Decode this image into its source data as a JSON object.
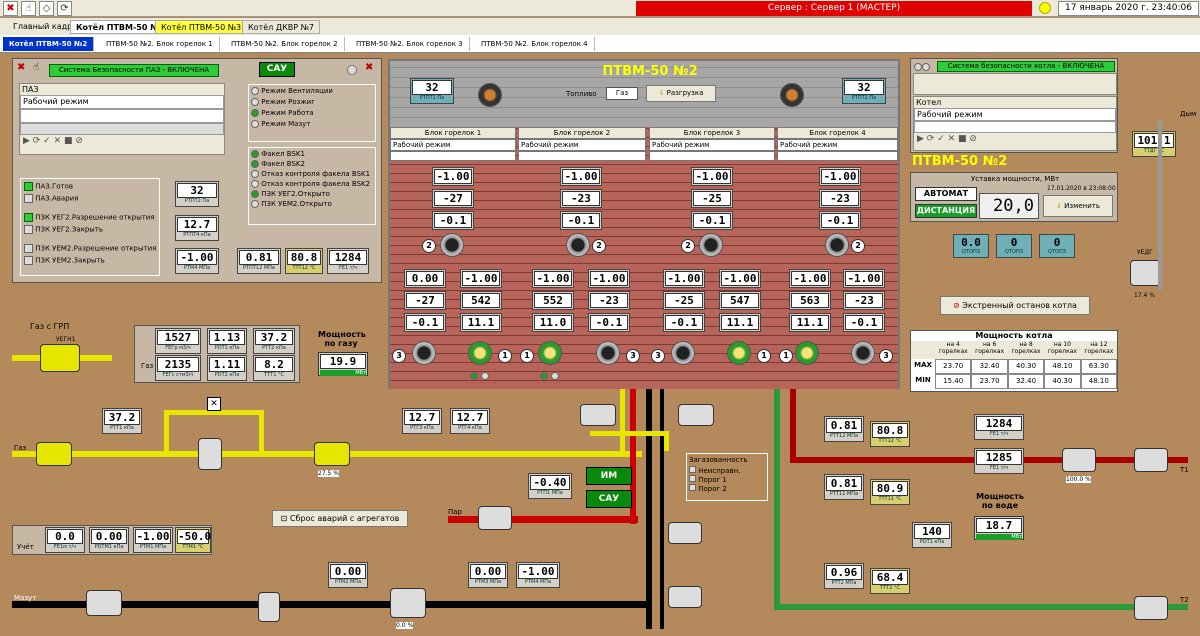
{
  "topbar": {
    "server": "Сервер : Сервер 1 (МАСТЕР)",
    "clock": "17 январь 2020 г. 23:40:06"
  },
  "tabs1": [
    "Главный кадр",
    "Котёл ПТВМ-50 №2",
    "Котёл ПТВМ-50 №3",
    "Котёл ДКВР №7"
  ],
  "tabs2": [
    "Котёл ПТВМ-50 №2",
    "ПТВМ-50 №2. Блок горелок 1",
    "ПТВМ-50 №2. Блок горелок 2",
    "ПТВМ-50 №2. Блок горелок 3",
    "ПТВМ-50 №2. Блок горелок 4"
  ],
  "paz": {
    "status": "Система Безопасности ПАЗ - ВКЛЮЧЕНА",
    "sau": "САУ",
    "title": "ПАЗ",
    "mode": "Рабочий режим",
    "modes": [
      "Режим Вентиляции",
      "Режим Розжиг",
      "Режим Работа",
      "Режим Мазут"
    ],
    "flares": [
      "Факел BSK1",
      "Факел BSK2",
      "Отказ контроля факела BSK1",
      "Отказ контроля факела BSK2",
      "ПЗК УЕГ2.Открыто",
      "ПЗК УЕМ2.Открыто"
    ],
    "flags1": [
      "ПАЗ.Готов",
      "ПАЗ.Авария"
    ],
    "flags2": [
      "ПЗК УЕГ2.Разрешение открытия",
      "ПЗК УЕГ2.Закрыть"
    ],
    "flags3": [
      "ПЗК УЕМ2.Разрешение открытия",
      "ПЗК УЕМ2.Закрыть"
    ]
  },
  "center": {
    "title": "ПТВМ-50 №2",
    "fuel_label": "Топливо",
    "fuel": "Газ",
    "unload": "Разгрузка",
    "rtpt1": "32",
    "rtpt2": "32"
  },
  "blocks": [
    {
      "name": "Блок горелок 1",
      "mode": "Рабочий режим",
      "top": [
        "-1.00",
        "-27",
        "-0.1"
      ],
      "l": [
        "0.00",
        "-27",
        "-0.1"
      ],
      "r": [
        "-1.00",
        "542",
        "11.1"
      ]
    },
    {
      "name": "Блок горелок 2",
      "mode": "Рабочий режим",
      "top": [
        "-1.00",
        "-23",
        "-0.1"
      ],
      "l": [
        "-1.00",
        "552",
        "11.0"
      ],
      "r": [
        "-1.00",
        "-23",
        "-0.1"
      ]
    },
    {
      "name": "Блок горелок 3",
      "mode": "Рабочий режим",
      "top": [
        "-1.00",
        "-25",
        "-0.1"
      ],
      "l": [
        "-1.00",
        "-25",
        "-0.1"
      ],
      "r": [
        "-1.00",
        "547",
        "11.1"
      ]
    },
    {
      "name": "Блок горелок 4",
      "mode": "Рабочий режим",
      "top": [
        "-1.00",
        "-23",
        "-0.1"
      ],
      "l": [
        "-1.00",
        "563",
        "11.1"
      ],
      "r": [
        "-1.00",
        "-23",
        "-0.1"
      ]
    }
  ],
  "right": {
    "status": "Система безопасности котла - ВКЛЮЧЕНА",
    "kotel": "Котел",
    "mode": "Рабочий режим",
    "title": "ПТВМ-50 №2",
    "setpoint_label": "Уставка мощности, МВт",
    "setdate": "17.01.2020 в 23:08:00",
    "auto": "АВТОМАТ",
    "dist": "ДИСТАНЦИЯ",
    "setval": "20,0",
    "change": "Изменить",
    "ttg": "101.1",
    "q1": "0.0",
    "q2": "0",
    "q3": "0",
    "estop": "Экстренный останов котла",
    "dym": "Дым",
    "uedg": "УЕДГ",
    "uedg_pct": "17.4 %",
    "power_title": "Мощность котла",
    "power_cols": [
      "на 4 горелках",
      "на 6 горелках",
      "на 8 горелках",
      "на 10 горелках",
      "на 12 горелках"
    ],
    "max": [
      "23.70",
      "32.40",
      "40.30",
      "48.10",
      "63.30"
    ],
    "min": [
      "15.40",
      "23.70",
      "32.40",
      "40.30",
      "48.10"
    ]
  },
  "gas": {
    "grp": "Газ с ГРП",
    "uegn1": "УЕГН1",
    "fegr": "1527",
    "rdt1": "1.13",
    "rtt2": "37.2",
    "fegs": "2135",
    "rdt2": "1.11",
    "ttt1": "8.2",
    "label": "Газ",
    "power_label": "Мощность по газу",
    "power": "19.9",
    "rtt1": "37.2",
    "rtg3": "12.7",
    "rtg4": "12.7",
    "rtpt2b": "32",
    "rtpt4": "12.7",
    "rtm4": "-1.00",
    "rtpt12": "0.81",
    "ttt12a": "80.8",
    "fe1a": "1284",
    "ueg3_pct": "27.5 %",
    "reset": "Сброс аварий с агрегатов"
  },
  "steam": {
    "par": "Пар",
    "rtp1": "-0.40",
    "im": "ИМ",
    "sau": "САУ",
    "zag": "Загазованность",
    "zag_items": [
      "Неисправн.",
      "Порог 1",
      "Порог 2"
    ]
  },
  "oil": {
    "uchet": "Учёт",
    "fe1m": "0.0",
    "rdtm1": "0.00",
    "rtm1": "-1.00",
    "ttm1": "-50.0",
    "mazut": "Мазут",
    "rtm2": "0.00",
    "rtm3": "0.00",
    "rtm4b": "-1.00",
    "uem3_pct": "0.0 %"
  },
  "water": {
    "rtt12": "0.81",
    "ttt12": "80.8",
    "rtt11": "0.81",
    "ttt11": "80.9",
    "fe1": "1284",
    "fe1b": "1285",
    "power_label": "Мощность по воде",
    "power": "18.7",
    "rdt1": "140",
    "rtt2": "0.96",
    "ttt2": "68.4",
    "t1": "Т1",
    "t2": "Т2",
    "pct": "100.0 %"
  }
}
